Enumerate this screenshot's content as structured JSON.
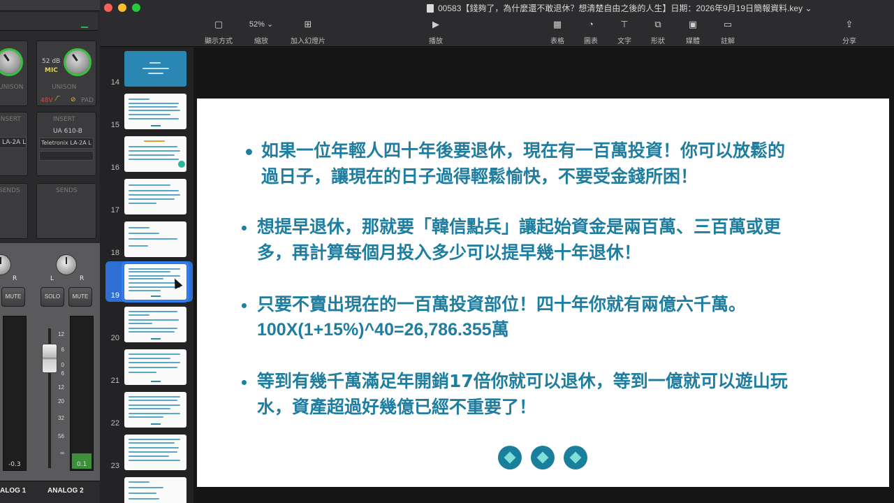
{
  "window": {
    "title": "00583【錢夠了，為什麼還不敢退休？想清楚自由之後的人生】日期：2026年9月19日簡報資料.key"
  },
  "toolbar": {
    "view_label": "顯示方式",
    "zoom_value": "52%",
    "zoom_label": "縮放",
    "add_slide_label": "加入幻燈片",
    "play_label": "播放",
    "table_label": "表格",
    "chart_label": "圖表",
    "text_label": "文字",
    "shape_label": "形狀",
    "media_label": "媒體",
    "comment_label": "註解",
    "share_label": "分享"
  },
  "navigator": {
    "selected_slide": 19,
    "slides": [
      "14",
      "15",
      "16",
      "17",
      "18",
      "19",
      "20",
      "21",
      "22",
      "23"
    ]
  },
  "slide": {
    "bullets": [
      {
        "line1": "如果一位年輕人四十年後要退休，現在有一百萬投資！你可以放鬆的",
        "line2": "過日子，讓現在的日子過得輕鬆愉快，不要受金錢所困！"
      },
      {
        "line1": "想提早退休，那就要「韓信點兵」讓起始資金是兩百萬、三百萬或更",
        "line2": "多，再計算每個月投入多少可以提早幾十年退休！"
      },
      {
        "line1": "只要不賣出現在的一百萬投資部位！四十年你就有兩億六千萬。",
        "line2": "100X(1+15%)^40=26,786.355萬"
      },
      {
        "line1": "等到有幾千萬滿足年開銷17倍你就可以退休，等到一億就可以遊山玩",
        "line2": "水，資產超過好幾億已經不重要了！"
      }
    ]
  },
  "console": {
    "gain": "52 dB",
    "mic": "MIC",
    "unison": "UNISON",
    "phantom": "48V",
    "pad": "PAD",
    "insert": "INSERT",
    "plugin1": "UA 610-B",
    "plugin2": "Teletronix LA-2A L",
    "plugin2_left": "LA-2A L",
    "sends": "SENDS",
    "solo": "SOLO",
    "mute": "MUTE",
    "mute2": "MUTE",
    "meter_left": "-0.3",
    "meter_right": "0.1",
    "scale": [
      "12",
      "6",
      "0",
      "6",
      "12",
      "20",
      "32",
      "56"
    ],
    "analog1": "ALOG 1",
    "analog2": "ANALOG 2"
  },
  "colors": {
    "accent": "#1f7ea0",
    "selection": "#2f7ff0",
    "knob_ring": "#35c53b"
  }
}
